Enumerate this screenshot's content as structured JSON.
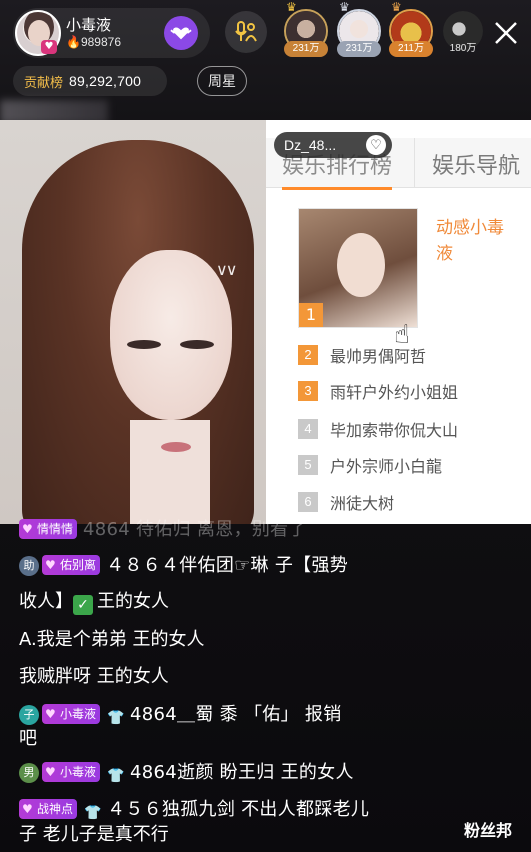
{
  "header": {
    "host_name": "小毒液",
    "host_fans": "989876",
    "follow_icon": "heart-wings-icon",
    "mic_icon": "mic-link-icon",
    "viewers": [
      {
        "badge": "231万",
        "crown": "gold"
      },
      {
        "badge": "231万",
        "crown": "silver"
      },
      {
        "badge": "211万",
        "crown": "bronze"
      },
      {
        "badge": "180万",
        "crown": "none"
      }
    ],
    "close_icon": "close-icon"
  },
  "contribution": {
    "label": "贡献榜",
    "value": "89,292,700",
    "week_star": "周星"
  },
  "overlay": {
    "collapse_icon": "double-chevron-down-icon",
    "dz_name": "Dz_48...",
    "dz_icon": "heart-plus-icon"
  },
  "ranking": {
    "tabs": [
      "娱乐排行榜",
      "娱乐导航"
    ],
    "top_name": "动感小毒液",
    "top_rank": "1",
    "items": [
      {
        "rank": "2",
        "name": "最帅男偶阿哲"
      },
      {
        "rank": "3",
        "name": "雨轩户外约小姐姐"
      },
      {
        "rank": "4",
        "name": "毕加索带你侃大山"
      },
      {
        "rank": "5",
        "name": "户外宗师小白龍"
      },
      {
        "rank": "6",
        "name": "洲徒大树"
      }
    ]
  },
  "chat": {
    "lines": [
      {
        "fan_badge": "情情情",
        "text": "4864 待佑归 离恩，别看了"
      },
      {
        "level": "助",
        "fan_badge": "佑别离",
        "text": "４８６４伴佑团☞琳 子【强势",
        "cont": "收人】",
        "gift": "check",
        "tail": "王的女人"
      },
      {
        "text": "A.我是个弟弟 王的女人"
      },
      {
        "text": "我贼胖呀 王的女人"
      },
      {
        "level": "子",
        "fan_badge": "小毒液",
        "gift": "shirt",
        "text": "4864＿蜀 黍 「佑」 报销",
        "cont": "吧"
      },
      {
        "level": "男",
        "fan_badge": "小毒液",
        "gift": "shirt",
        "text": "4864逝颜 盼王归 王的女人"
      },
      {
        "fan_badge": "战神点",
        "gift": "shirt",
        "text": "４５６独孤九剑 不出人都踩老儿",
        "cont": "子 老儿子是真不行"
      }
    ]
  },
  "watermark": "粉丝邦",
  "colors": {
    "accent": "#f39738",
    "fan_badge": "#b43ad6",
    "follow": "#8b49e6",
    "gold": "#f2bd4a"
  }
}
